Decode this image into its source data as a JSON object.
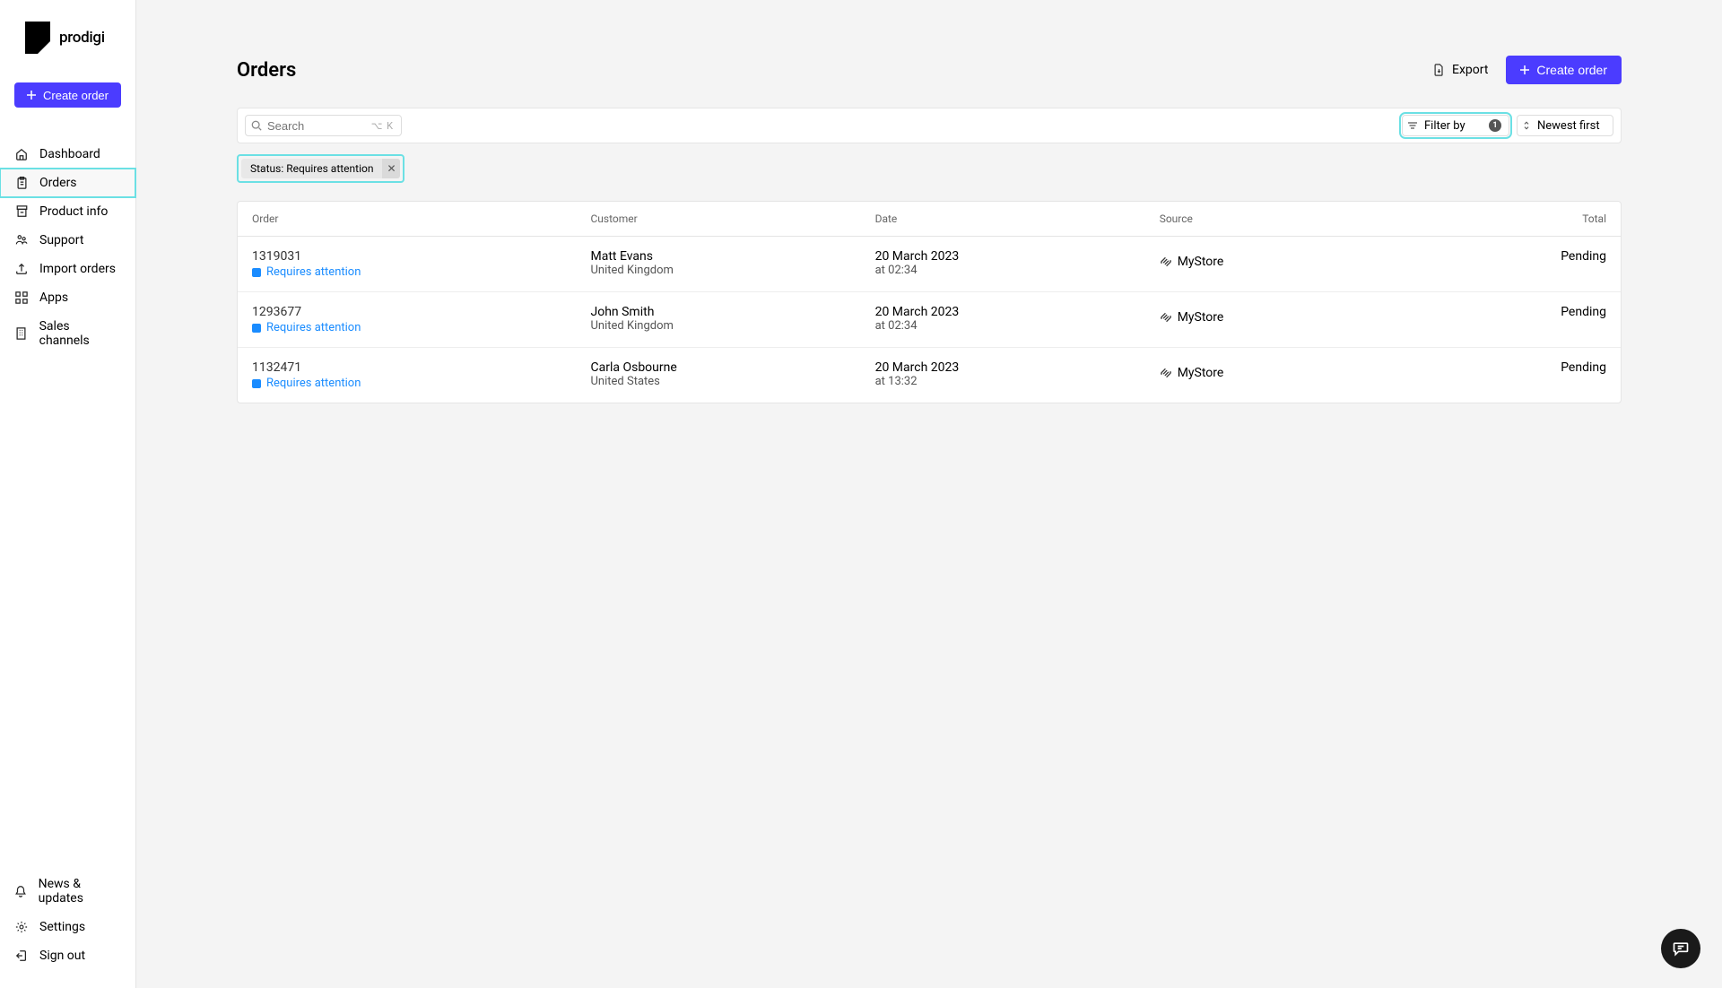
{
  "brand": {
    "name": "prodigi"
  },
  "sidebar": {
    "create_label": "Create order",
    "nav": [
      {
        "label": "Dashboard"
      },
      {
        "label": "Orders"
      },
      {
        "label": "Product info"
      },
      {
        "label": "Support"
      },
      {
        "label": "Import orders"
      },
      {
        "label": "Apps"
      },
      {
        "label": "Sales channels"
      }
    ],
    "footer": [
      {
        "label": "News & updates"
      },
      {
        "label": "Settings"
      },
      {
        "label": "Sign out"
      }
    ]
  },
  "page": {
    "title": "Orders",
    "export_label": "Export",
    "create_order_label": "Create order"
  },
  "search": {
    "placeholder": "Search",
    "shortcut": "⌥ K"
  },
  "filter": {
    "label": "Filter by",
    "count": "1"
  },
  "sort": {
    "label": "Newest first"
  },
  "activeFilter": {
    "text": "Status: Requires attention"
  },
  "table": {
    "headers": {
      "order": "Order",
      "customer": "Customer",
      "date": "Date",
      "source": "Source",
      "total": "Total"
    },
    "rows": [
      {
        "id": "1319031",
        "status": "Requires attention",
        "customer": "Matt Evans",
        "country": "United Kingdom",
        "date": "20 March 2023",
        "time": "at 02:34",
        "source": "MyStore",
        "total": "Pending"
      },
      {
        "id": "1293677",
        "status": "Requires attention",
        "customer": "John Smith",
        "country": "United Kingdom",
        "date": "20 March 2023",
        "time": "at 02:34",
        "source": "MyStore",
        "total": "Pending"
      },
      {
        "id": "1132471",
        "status": "Requires attention",
        "customer": "Carla Osbourne",
        "country": "United States",
        "date": "20 March 2023",
        "time": "at 13:32",
        "source": "MyStore",
        "total": "Pending"
      }
    ]
  }
}
